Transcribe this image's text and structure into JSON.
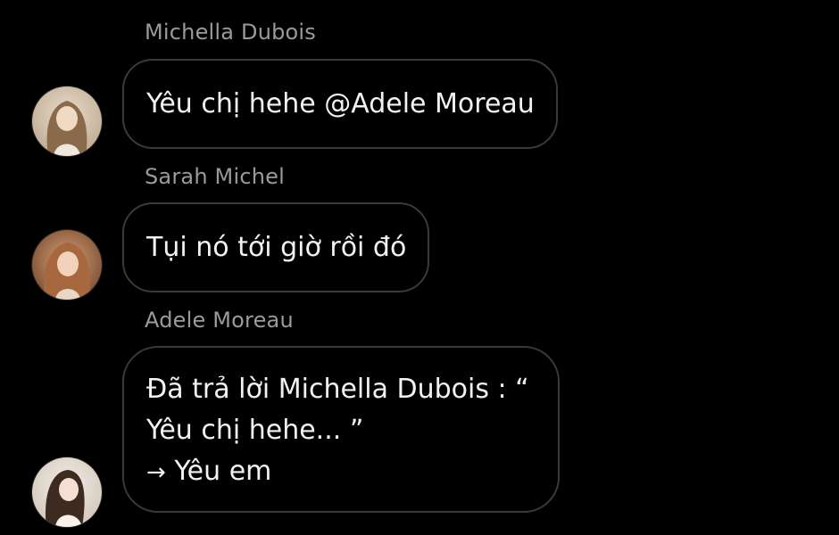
{
  "messages": [
    {
      "sender": "Michella Dubois",
      "text": "Yêu chị hehe @Adele Moreau"
    },
    {
      "sender": "Sarah Michel",
      "text": "Tụi nó tới giờ rồi đó"
    },
    {
      "sender": "Adele Moreau",
      "reply_line_1": "Đã trả lời Michella Dubois : “",
      "reply_line_2": "Yêu chị hehe... ”",
      "reply_arrow": "→",
      "reply_text": "Yêu em"
    }
  ],
  "colors": {
    "background": "#000000",
    "bubble_border": "#3a3a3a",
    "sender_name": "#9a9a9a",
    "message_text": "#f2f2f2"
  },
  "icons": [
    "avatar-michella",
    "avatar-sarah",
    "avatar-adele"
  ]
}
